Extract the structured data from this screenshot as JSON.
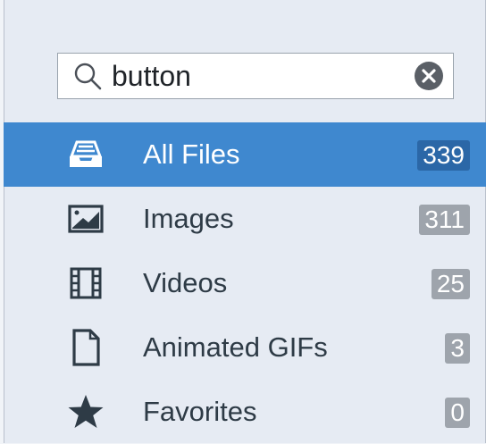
{
  "search": {
    "value": "button",
    "icon": "search-icon",
    "clear_icon": "close-circle-icon"
  },
  "sidebar": {
    "items": [
      {
        "label": "All Files",
        "count": "339",
        "icon": "inbox-tray-icon",
        "selected": true
      },
      {
        "label": "Images",
        "count": "311",
        "icon": "image-icon",
        "selected": false
      },
      {
        "label": "Videos",
        "count": "25",
        "icon": "film-icon",
        "selected": false
      },
      {
        "label": "Animated GIFs",
        "count": "3",
        "icon": "document-icon",
        "selected": false
      },
      {
        "label": "Favorites",
        "count": "0",
        "icon": "star-icon",
        "selected": false
      }
    ]
  },
  "colors": {
    "background": "#e6ebf3",
    "selected_row": "#3f88cf",
    "selected_badge": "#2b67a7",
    "badge": "#9ea4ac",
    "text": "#2e3b46"
  }
}
